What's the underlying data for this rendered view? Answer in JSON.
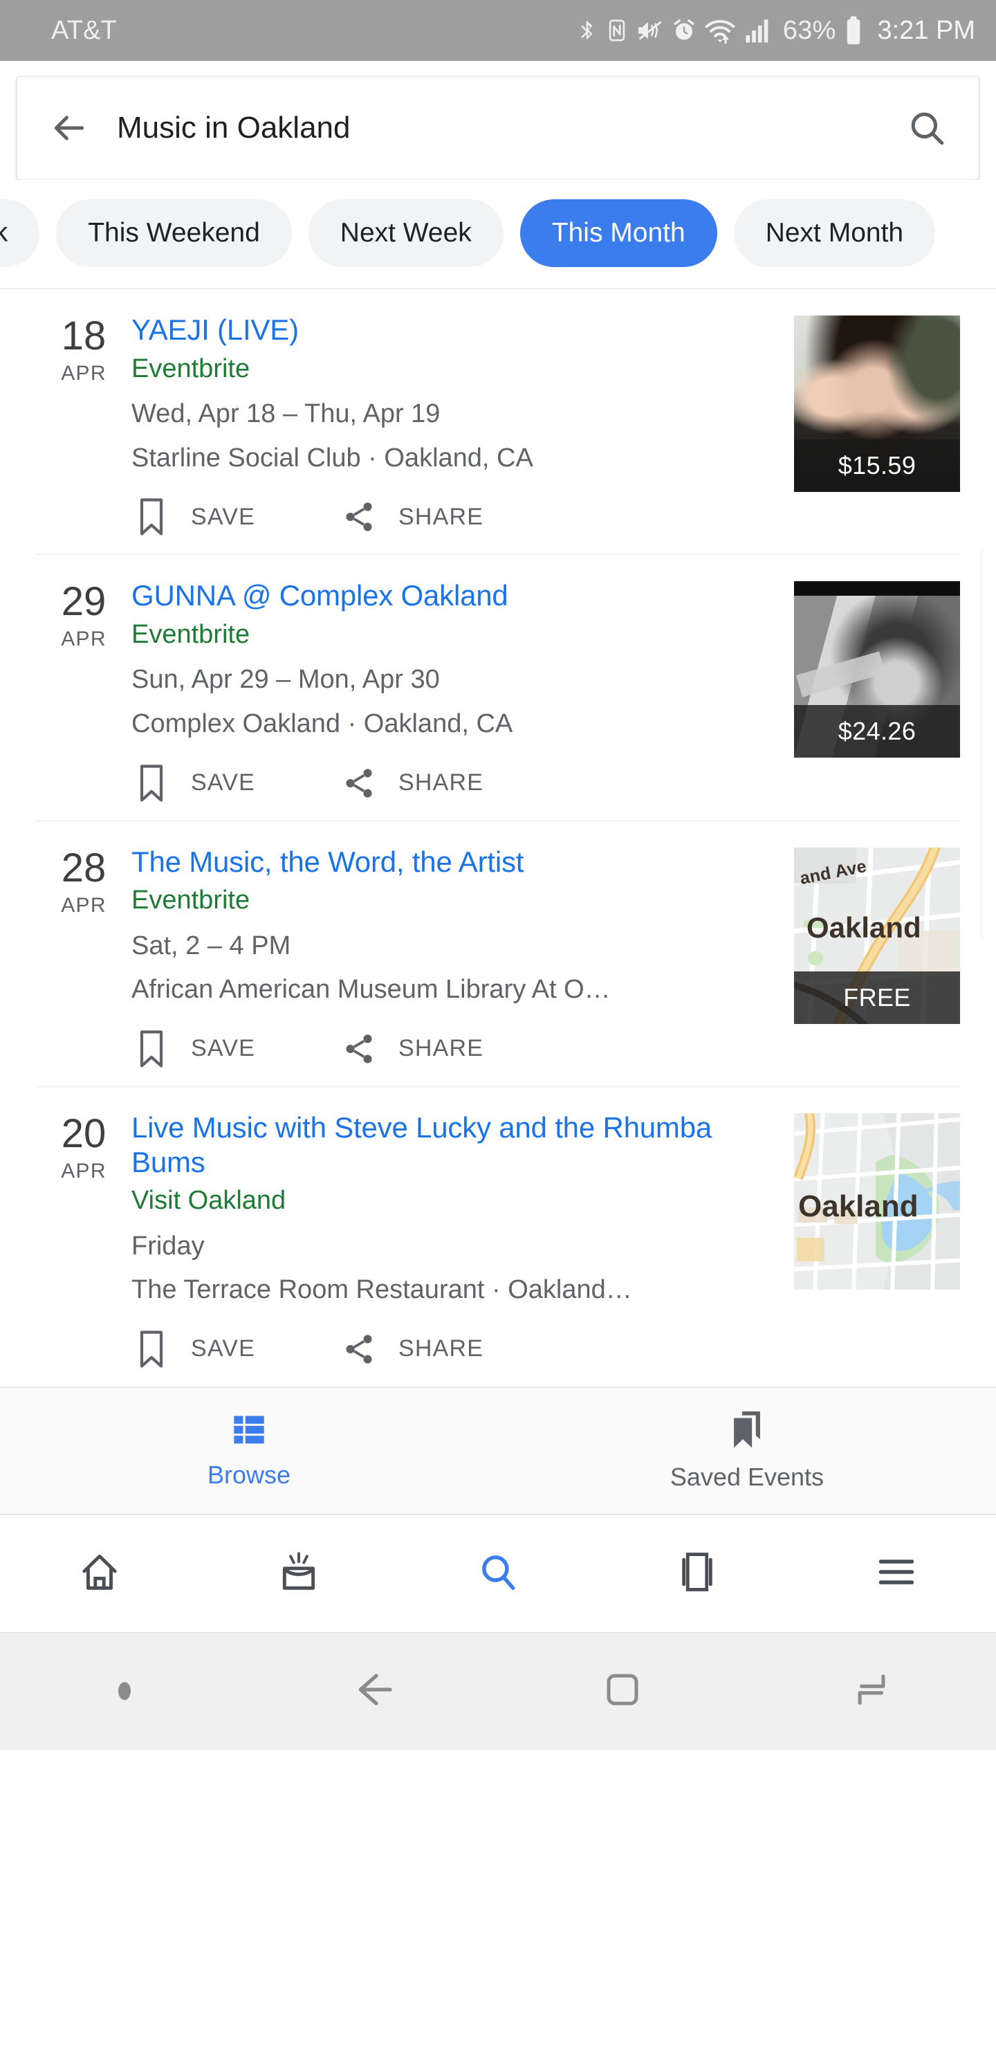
{
  "status_bar": {
    "carrier": "AT&T",
    "battery_percent": "63%",
    "time": "3:21 PM",
    "icons": [
      "bluetooth-icon",
      "nfc-icon",
      "mute-vibrate-icon",
      "alarm-icon",
      "wifi-icon",
      "cellular-signal-icon",
      "battery-icon"
    ]
  },
  "search": {
    "query": "Music in Oakland",
    "back_icon": "back-arrow-icon",
    "search_icon": "search-icon"
  },
  "filter_chips": [
    {
      "label": "ek",
      "selected": false,
      "truncated": true
    },
    {
      "label": "This Weekend",
      "selected": false
    },
    {
      "label": "Next Week",
      "selected": false
    },
    {
      "label": "This Month",
      "selected": true
    },
    {
      "label": "Next Month",
      "selected": false
    }
  ],
  "events": [
    {
      "day": "18",
      "month": "APR",
      "title": "YAEJI (LIVE)",
      "source": "Eventbrite",
      "when": "Wed, Apr 18 – Thu, Apr 19",
      "where": "Starline Social Club · Oakland, CA",
      "thumb_type": "photo",
      "price": "$15.59",
      "save_label": "SAVE",
      "share_label": "SHARE"
    },
    {
      "day": "29",
      "month": "APR",
      "title": "GUNNA @ Complex Oakland",
      "source": "Eventbrite",
      "when": "Sun, Apr 29 – Mon, Apr 30",
      "where": "Complex Oakland · Oakland, CA",
      "thumb_type": "photo",
      "price": "$24.26",
      "save_label": "SAVE",
      "share_label": "SHARE"
    },
    {
      "day": "28",
      "month": "APR",
      "title": "The Music, the Word, the Artist",
      "source": "Eventbrite",
      "when": "Sat, 2 – 4 PM",
      "where": "African American Museum Library At O…",
      "thumb_type": "map",
      "map_city_label": "Oakland",
      "map_street_label": "and Ave",
      "price": "FREE",
      "save_label": "SAVE",
      "share_label": "SHARE"
    },
    {
      "day": "20",
      "month": "APR",
      "title": "Live Music with Steve Lucky and the Rhumba Bums",
      "source": "Visit Oakland",
      "when": "Friday",
      "where": "The Terrace Room Restaurant · Oakland…",
      "thumb_type": "map",
      "map_city_label": "Oakland",
      "price": "",
      "save_label": "SAVE",
      "share_label": "SHARE"
    }
  ],
  "site_tabs": [
    {
      "label": "Browse",
      "icon": "list-grid-icon",
      "active": true
    },
    {
      "label": "Saved Events",
      "icon": "bookmarks-icon",
      "active": false
    }
  ],
  "browser_toolbar": [
    {
      "icon": "home-icon",
      "active": false
    },
    {
      "icon": "discover-icon",
      "active": false
    },
    {
      "icon": "search-icon",
      "active": true
    },
    {
      "icon": "tabs-icon",
      "active": false
    },
    {
      "icon": "menu-icon",
      "active": false
    }
  ],
  "android_nav": [
    {
      "icon": "dot-indicator-icon"
    },
    {
      "icon": "back-icon"
    },
    {
      "icon": "home-icon"
    },
    {
      "icon": "recents-icon"
    }
  ],
  "colors": {
    "accent_blue": "#3b7ded",
    "link_blue": "#1a73e8",
    "source_green": "#1e7a34",
    "status_bar_gray": "#9e9e9e",
    "text_secondary": "#5f6368"
  }
}
